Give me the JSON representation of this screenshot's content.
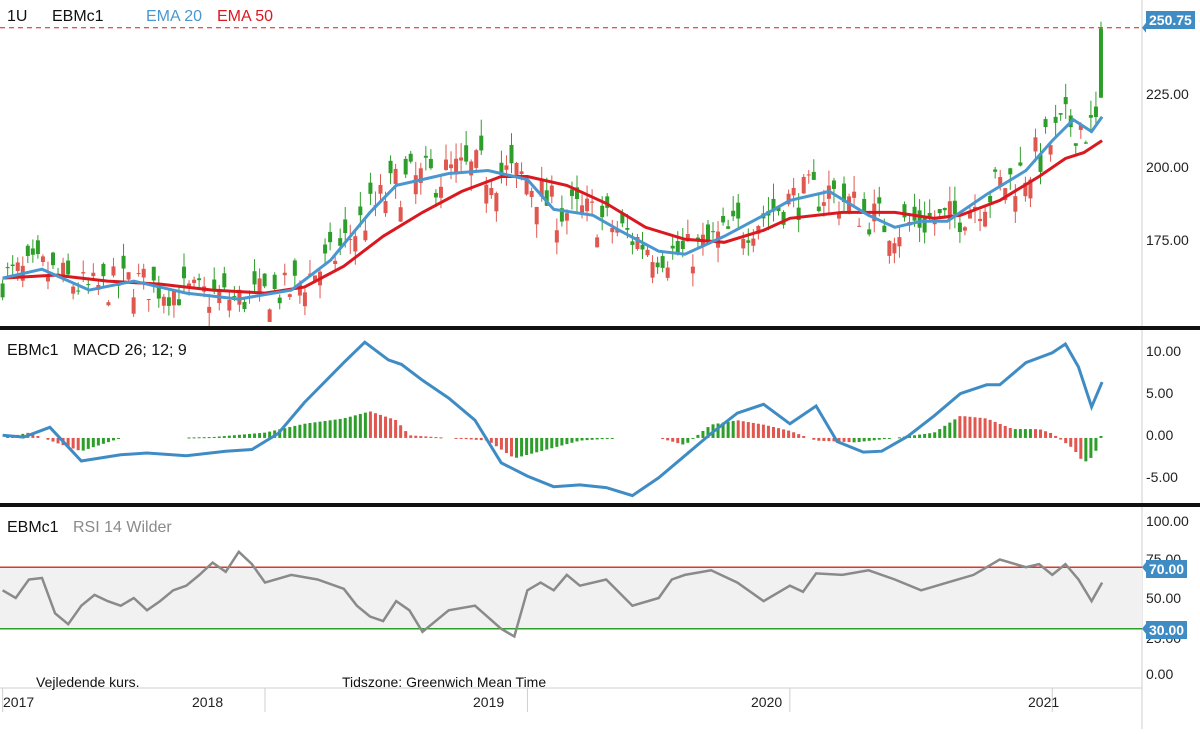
{
  "colors": {
    "up": "#2e9e2a",
    "down": "#e0574f",
    "ema20": "#4a97cf",
    "ema50": "#d9191f",
    "macd": "#3f8cc5",
    "rsi": "#8a8a8a",
    "rsi_band": "#f1f1f1",
    "rsi_upper_line": "#d93a2b",
    "rsi_lower_line": "#2e9e2a",
    "price_tag": "#3f8cc5",
    "divider": "#111111"
  },
  "price_panel": {
    "interval": "1U",
    "symbol": "EBMc1",
    "ema20_label": "EMA 20",
    "ema50_label": "EMA 50",
    "last_price": "250.75",
    "y_ticks": [
      "225.00",
      "200.00",
      "175.00"
    ]
  },
  "macd_panel": {
    "symbol": "EBMc1",
    "label": "MACD 26; 12; 9",
    "y_ticks": [
      "10.00",
      "5.00",
      "0.00",
      "-5.00"
    ]
  },
  "rsi_panel": {
    "symbol": "EBMc1",
    "label": "RSI 14 Wilder",
    "y_ticks": [
      "100.00",
      "75.00",
      "50.00",
      "25.00",
      "0.00"
    ],
    "upper_tag": "70.00",
    "lower_tag": "30.00"
  },
  "footer": {
    "note": "Vejledende kurs.",
    "timezone": "Tidszone: Greenwich Mean Time",
    "x_ticks": [
      "2017",
      "2018",
      "2019",
      "2020",
      "2021"
    ]
  },
  "chart_data": [
    {
      "type": "candlestick",
      "x_range": [
        2016.99,
        2021.22
      ],
      "ylim": [
        153,
        254
      ],
      "last_price": 250.75,
      "series": [
        {
          "name": "EMA 20",
          "x": [
            2017.0,
            2017.15,
            2017.33,
            2017.5,
            2017.7,
            2017.9,
            2018.1,
            2018.25,
            2018.4,
            2018.5,
            2018.6,
            2018.7,
            2018.85,
            2019.0,
            2019.1,
            2019.25,
            2019.35,
            2019.5,
            2019.6,
            2019.75,
            2019.9,
            2020.0,
            2020.15,
            2020.3,
            2020.4,
            2020.5,
            2020.6,
            2020.75,
            2020.9,
            2021.0,
            2021.08,
            2021.15,
            2021.19
          ],
          "y": [
            167,
            170,
            163,
            166,
            162,
            160,
            163,
            173,
            189,
            198,
            200,
            202,
            203,
            200,
            190,
            188,
            183,
            176,
            175,
            181,
            188,
            193,
            196,
            188,
            184,
            186,
            186,
            195,
            203,
            213,
            220,
            216,
            221
          ]
        },
        {
          "name": "EMA 50",
          "x": [
            2017.0,
            2017.2,
            2017.4,
            2017.6,
            2017.8,
            2018.0,
            2018.15,
            2018.3,
            2018.45,
            2018.6,
            2018.75,
            2018.9,
            2019.0,
            2019.15,
            2019.3,
            2019.45,
            2019.6,
            2019.75,
            2019.9,
            2020.0,
            2020.2,
            2020.4,
            2020.55,
            2020.65,
            2020.8,
            2020.95,
            2021.05,
            2021.12,
            2021.19
          ],
          "y": [
            167,
            168,
            166,
            165,
            163,
            162,
            164,
            171,
            181,
            189,
            196,
            201,
            201,
            198,
            192,
            184,
            180,
            179,
            183,
            187,
            189,
            189,
            187,
            188,
            193,
            201,
            207,
            209,
            213
          ]
        }
      ],
      "candle_spec": {
        "period_years": 0.0192,
        "seed": 7
      }
    },
    {
      "type": "line+histogram",
      "ylim": [
        -7,
        11.5
      ],
      "series": [
        {
          "name": "MACD 26; 12; 9",
          "x": [
            2017.0,
            2017.08,
            2017.18,
            2017.3,
            2017.45,
            2017.55,
            2017.7,
            2017.85,
            2017.95,
            2018.05,
            2018.15,
            2018.3,
            2018.38,
            2018.47,
            2018.52,
            2018.6,
            2018.7,
            2018.8,
            2018.9,
            2019.0,
            2019.1,
            2019.2,
            2019.3,
            2019.4,
            2019.5,
            2019.6,
            2019.7,
            2019.8,
            2019.9,
            2020.0,
            2020.1,
            2020.18,
            2020.28,
            2020.35,
            2020.45,
            2020.55,
            2020.65,
            2020.75,
            2020.8,
            2020.9,
            2021.0,
            2021.05,
            2021.1,
            2021.15,
            2021.19
          ],
          "y": [
            0.3,
            0.1,
            1.2,
            -2.6,
            -1.9,
            -1.7,
            -2.0,
            -1.5,
            -1.3,
            0.5,
            4.0,
            8.5,
            10.8,
            8.8,
            8.3,
            6.5,
            4.5,
            2.0,
            -2.8,
            -4.3,
            -5.5,
            -5.3,
            -5.6,
            -6.5,
            -4.5,
            -2.0,
            0.5,
            2.8,
            3.8,
            1.6,
            3.6,
            -0.4,
            -1.6,
            -1.5,
            0.2,
            2.5,
            5.0,
            6.0,
            6.0,
            8.5,
            9.6,
            10.6,
            8.0,
            3.5,
            6.3
          ]
        },
        {
          "name": "Histogram",
          "x": [
            2017.0,
            2017.1,
            2017.2,
            2017.3,
            2017.45,
            2017.6,
            2017.8,
            2018.0,
            2018.15,
            2018.3,
            2018.4,
            2018.5,
            2018.55,
            2018.7,
            2018.85,
            2018.95,
            2019.05,
            2019.2,
            2019.35,
            2019.5,
            2019.6,
            2019.7,
            2019.8,
            2019.9,
            2020.0,
            2020.1,
            2020.25,
            2020.4,
            2020.55,
            2020.65,
            2020.75,
            2020.85,
            2020.95,
            2021.0,
            2021.08,
            2021.12,
            2021.16,
            2021.19
          ],
          "y": [
            0.0,
            0.6,
            -0.5,
            -1.5,
            0.0,
            0.0,
            0.1,
            0.6,
            1.6,
            2.2,
            3.0,
            2.0,
            0.3,
            0.0,
            -0.3,
            -2.3,
            -1.5,
            -0.3,
            0.0,
            0.0,
            -0.8,
            1.5,
            2.0,
            1.5,
            0.8,
            -0.3,
            -0.5,
            0.0,
            0.6,
            2.5,
            2.2,
            1.0,
            1.0,
            0.5,
            -1.2,
            -2.8,
            -2.0,
            0.6
          ]
        }
      ]
    },
    {
      "type": "line",
      "ylim": [
        0,
        100
      ],
      "upper_level": 70,
      "lower_level": 30,
      "series": [
        {
          "name": "RSI 14 Wilder",
          "x": [
            2017.0,
            2017.05,
            2017.1,
            2017.15,
            2017.2,
            2017.25,
            2017.3,
            2017.35,
            2017.4,
            2017.45,
            2017.5,
            2017.55,
            2017.6,
            2017.65,
            2017.7,
            2017.75,
            2017.8,
            2017.85,
            2017.9,
            2017.95,
            2018.0,
            2018.1,
            2018.2,
            2018.3,
            2018.35,
            2018.4,
            2018.45,
            2018.5,
            2018.55,
            2018.6,
            2018.7,
            2018.8,
            2018.9,
            2018.95,
            2019.0,
            2019.05,
            2019.1,
            2019.15,
            2019.2,
            2019.3,
            2019.4,
            2019.5,
            2019.55,
            2019.6,
            2019.7,
            2019.8,
            2019.9,
            2020.0,
            2020.05,
            2020.1,
            2020.2,
            2020.3,
            2020.4,
            2020.5,
            2020.6,
            2020.7,
            2020.8,
            2020.9,
            2020.95,
            2021.0,
            2021.05,
            2021.1,
            2021.15,
            2021.19
          ],
          "y": [
            55,
            50,
            62,
            63,
            40,
            33,
            45,
            52,
            48,
            45,
            50,
            42,
            48,
            55,
            58,
            65,
            73,
            67,
            80,
            72,
            60,
            65,
            62,
            56,
            45,
            38,
            35,
            48,
            42,
            28,
            42,
            45,
            30,
            25,
            55,
            60,
            55,
            65,
            58,
            62,
            45,
            50,
            62,
            65,
            68,
            60,
            48,
            58,
            54,
            66,
            65,
            68,
            62,
            55,
            60,
            65,
            75,
            70,
            72,
            65,
            72,
            62,
            48,
            60
          ]
        }
      ]
    }
  ]
}
